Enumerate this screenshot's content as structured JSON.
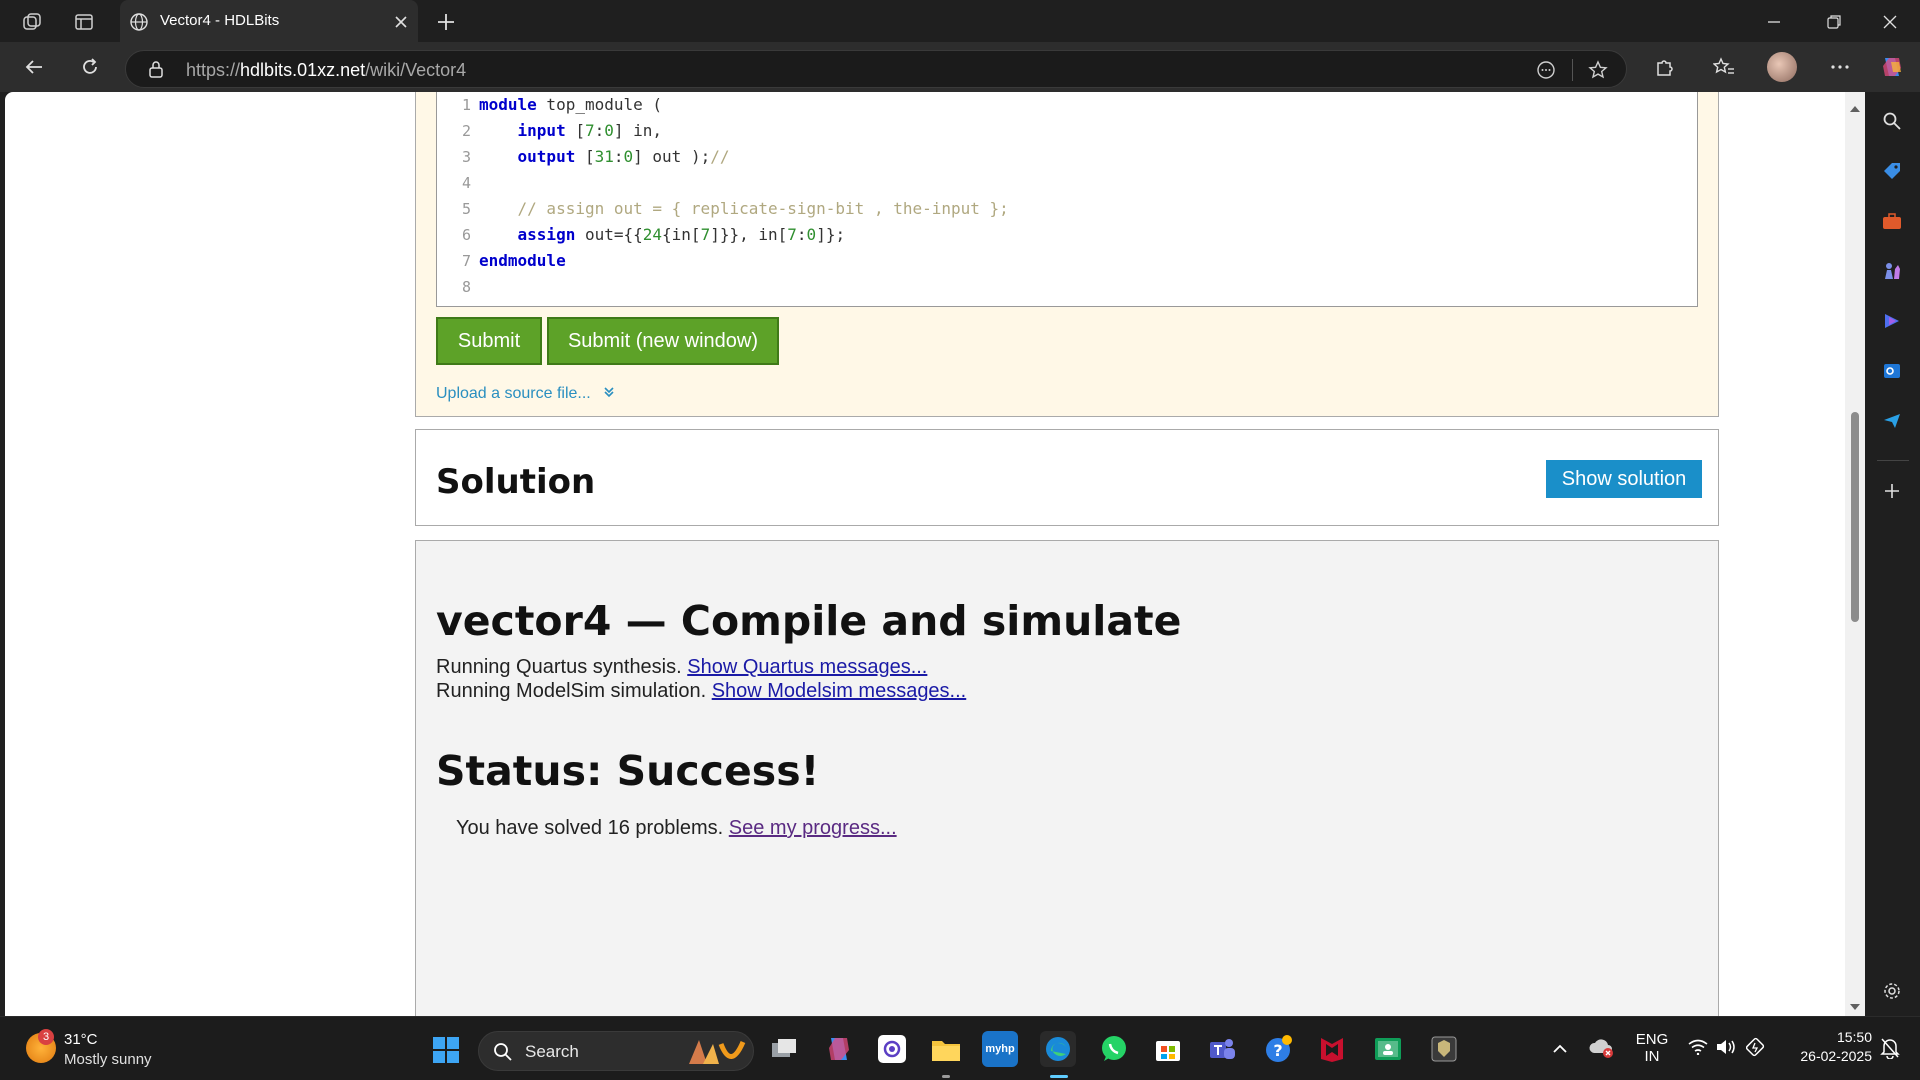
{
  "browser": {
    "tab_title": "Vector4 - HDLBits",
    "url_prefix": "https://",
    "url_host": "hdlbits.01xz.net",
    "url_path": "/wiki/Vector4"
  },
  "editor": {
    "lines": [
      {
        "num": "1",
        "tokens": [
          {
            "t": "module",
            "c": "kw"
          },
          {
            "t": " top_module (",
            "c": "pl"
          }
        ]
      },
      {
        "num": "2",
        "tokens": [
          {
            "t": "    ",
            "c": "pl"
          },
          {
            "t": "input",
            "c": "kw"
          },
          {
            "t": " [",
            "c": "pl"
          },
          {
            "t": "7",
            "c": "num"
          },
          {
            "t": ":",
            "c": "pl"
          },
          {
            "t": "0",
            "c": "num"
          },
          {
            "t": "] in,",
            "c": "pl"
          }
        ]
      },
      {
        "num": "3",
        "tokens": [
          {
            "t": "    ",
            "c": "pl"
          },
          {
            "t": "output",
            "c": "kw"
          },
          {
            "t": " [",
            "c": "pl"
          },
          {
            "t": "31",
            "c": "num"
          },
          {
            "t": ":",
            "c": "pl"
          },
          {
            "t": "0",
            "c": "num"
          },
          {
            "t": "] out );",
            "c": "pl"
          },
          {
            "t": "//",
            "c": "cm"
          }
        ]
      },
      {
        "num": "4",
        "tokens": []
      },
      {
        "num": "5",
        "tokens": [
          {
            "t": "    // assign out = { replicate-sign-bit , the-input };",
            "c": "cm"
          }
        ]
      },
      {
        "num": "6",
        "tokens": [
          {
            "t": "    ",
            "c": "pl"
          },
          {
            "t": "assign",
            "c": "kw"
          },
          {
            "t": " out={{",
            "c": "pl"
          },
          {
            "t": "24",
            "c": "num"
          },
          {
            "t": "{in[",
            "c": "pl"
          },
          {
            "t": "7",
            "c": "num"
          },
          {
            "t": "]}}, in[",
            "c": "pl"
          },
          {
            "t": "7",
            "c": "num"
          },
          {
            "t": ":",
            "c": "pl"
          },
          {
            "t": "0",
            "c": "num"
          },
          {
            "t": "]};",
            "c": "pl"
          }
        ]
      },
      {
        "num": "7",
        "tokens": [
          {
            "t": "endmodule",
            "c": "kw"
          }
        ]
      },
      {
        "num": "8",
        "tokens": []
      }
    ],
    "submit_label": "Submit",
    "submit_new_label": "Submit (new window)",
    "upload_label": "Upload a source file..."
  },
  "solution": {
    "title": "Solution",
    "show_label": "Show solution"
  },
  "result": {
    "title": "vector4 — Compile and simulate",
    "quartus_text": "Running Quartus synthesis. ",
    "quartus_link": "Show Quartus messages...",
    "modelsim_text": "Running ModelSim simulation. ",
    "modelsim_link": "Show Modelsim messages...",
    "status": "Status: Success!",
    "progress_text": "You have solved 16 problems. ",
    "progress_link": "See my progress..."
  },
  "taskbar": {
    "weather_badge": "3",
    "temperature": "31°C",
    "weather": "Mostly sunny",
    "search_label": "Search",
    "lang_top": "ENG",
    "lang_bottom": "IN",
    "time": "15:50",
    "date": "26-02-2025"
  }
}
